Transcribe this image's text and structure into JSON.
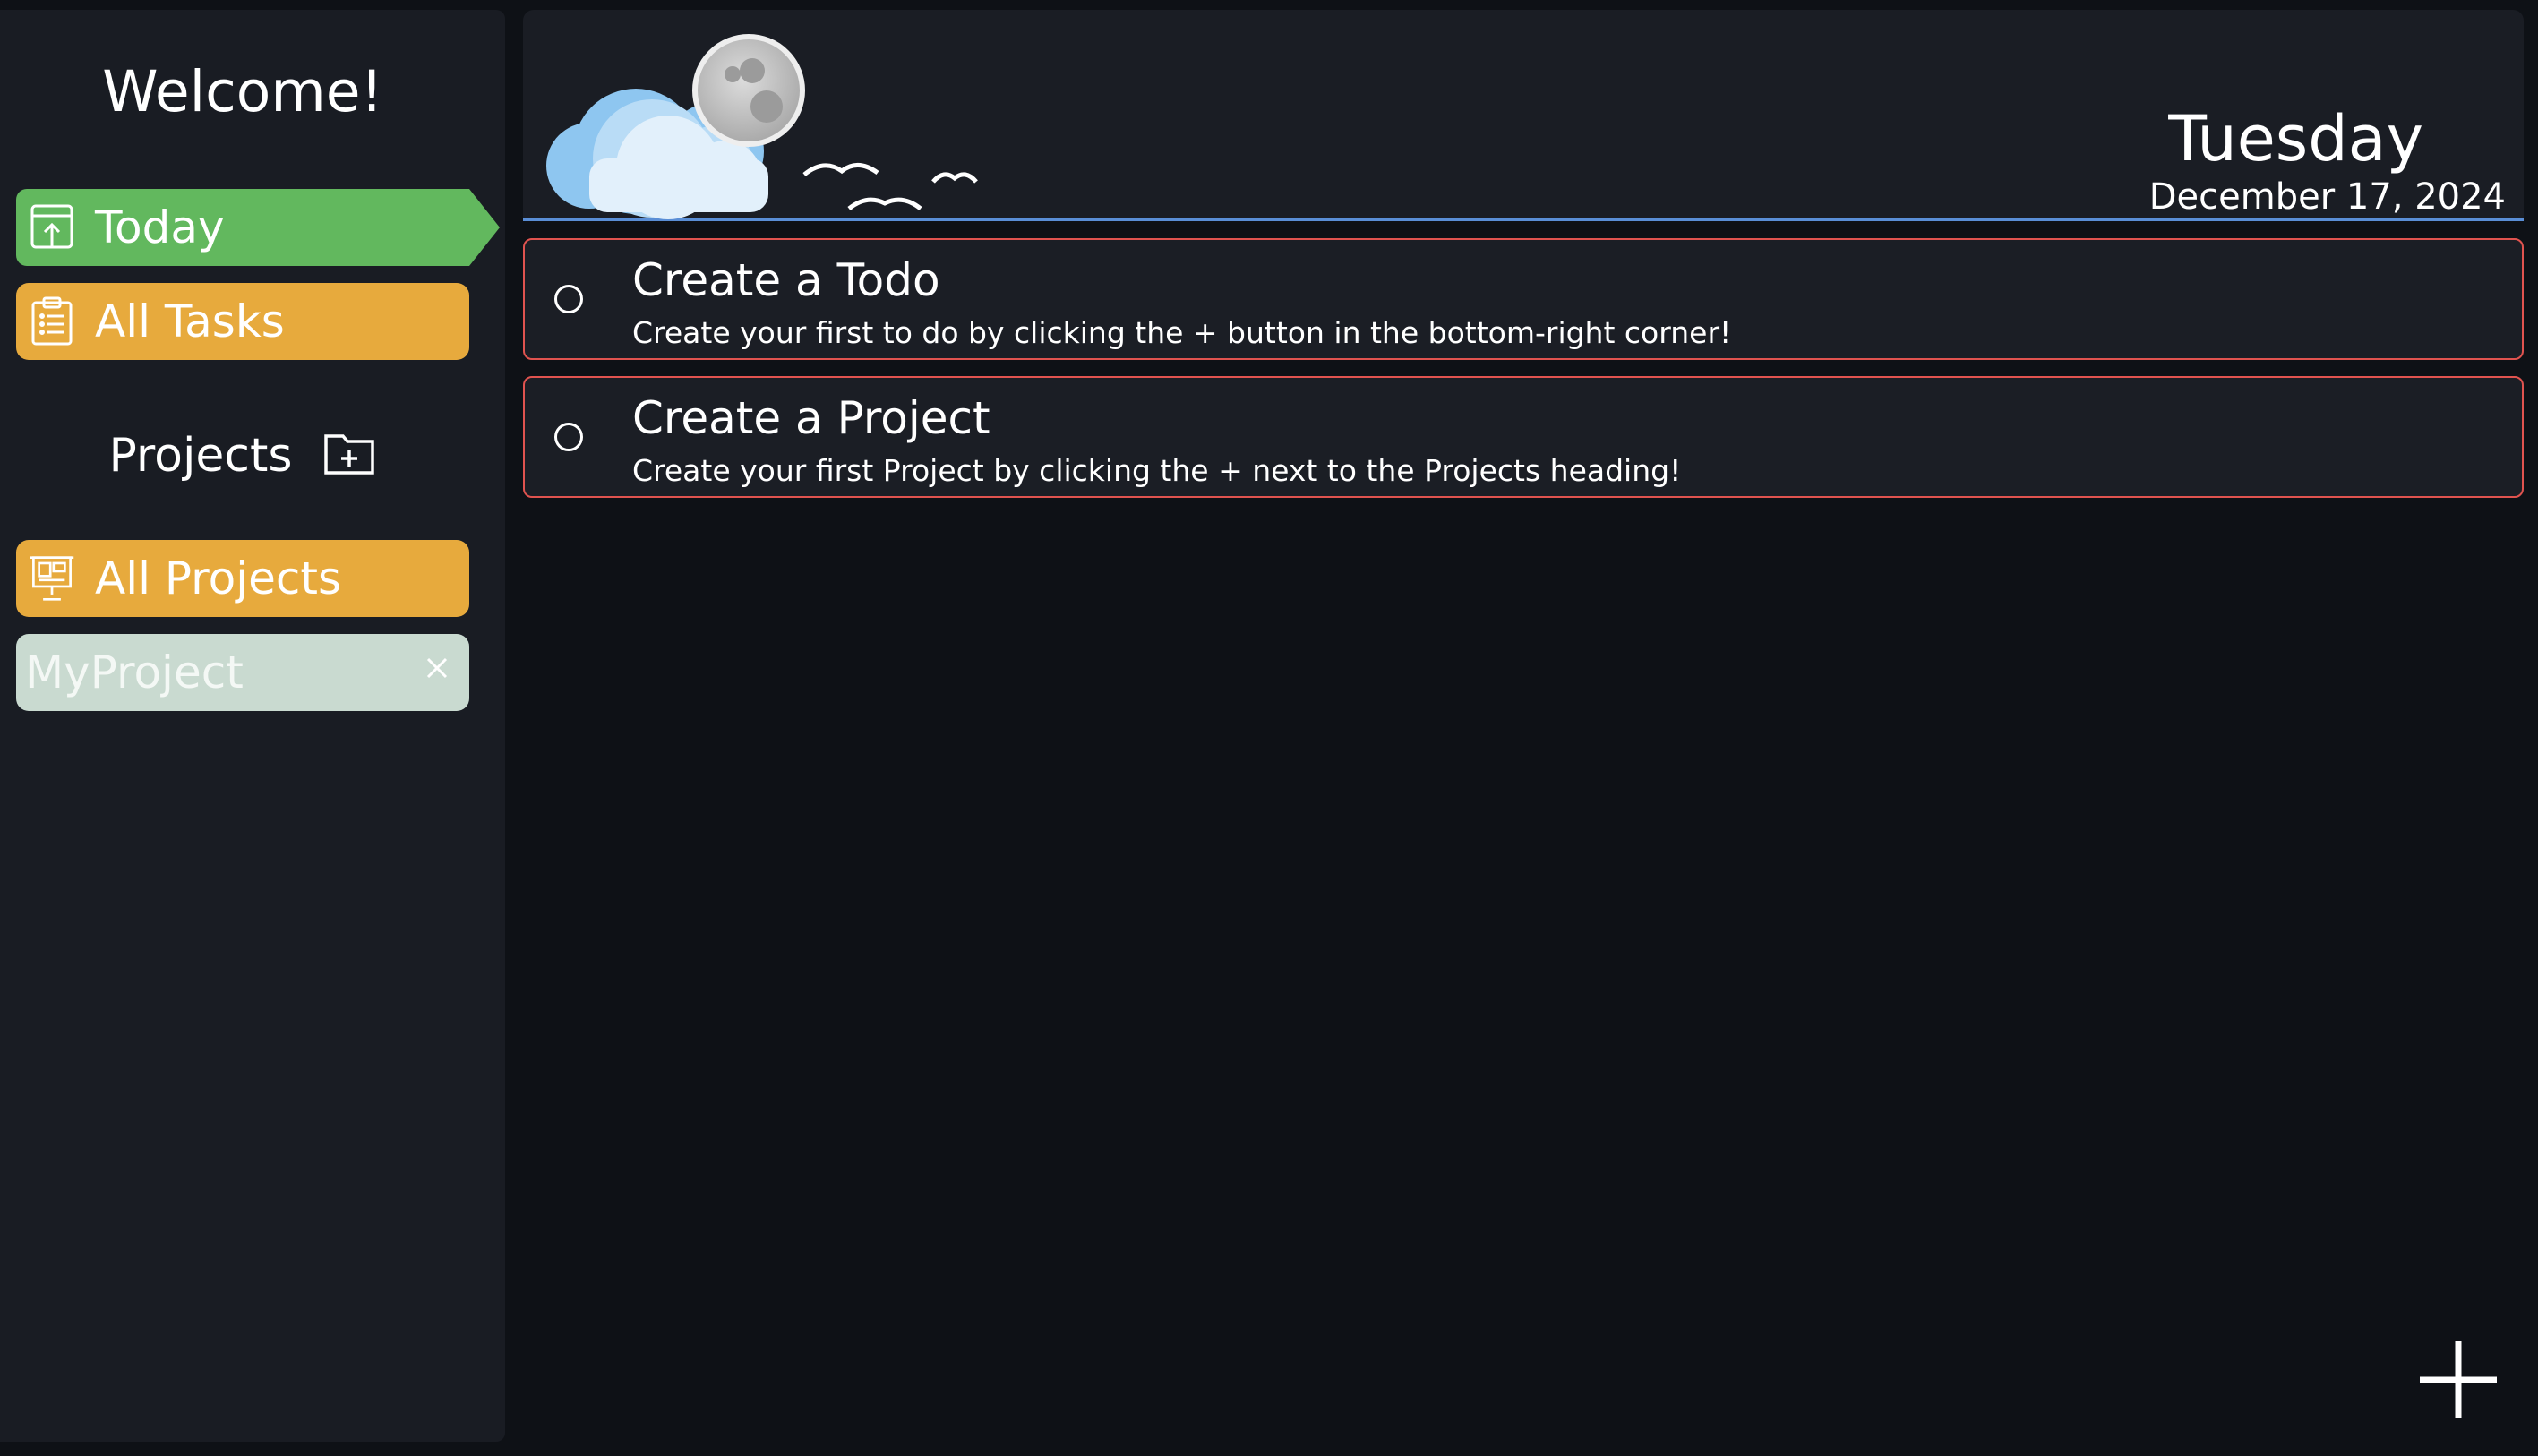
{
  "sidebar": {
    "welcome": "Welcome!",
    "nav": {
      "today": "Today",
      "all_tasks": "All Tasks"
    },
    "projects_heading": "Projects",
    "projects": {
      "all_projects": "All Projects",
      "items": [
        "MyProject"
      ]
    }
  },
  "header": {
    "day": "Tuesday",
    "date": "December 17, 2024",
    "weather_icon": "night-cloud-moon-birds"
  },
  "todos": [
    {
      "title": "Create a Todo",
      "description": "Create your first to do by clicking the + button in the bottom-right corner!"
    },
    {
      "title": "Create a Project",
      "description": "Create your first Project by clicking the + next to the Projects heading!"
    }
  ],
  "colors": {
    "background": "#0e1116",
    "panel": "#191c23",
    "today": "#62b85e",
    "all_tasks": "#e7aa3d",
    "my_project": "#c9dad0",
    "card_border": "#e0534f",
    "header_underline": "#5a8ed6"
  },
  "icons": {
    "today": "calendar-upload-icon",
    "all_tasks": "clipboard-list-icon",
    "add_project": "folder-plus-icon",
    "all_projects": "presentation-board-icon",
    "remove_project": "close-icon",
    "add_todo": "plus-icon"
  }
}
